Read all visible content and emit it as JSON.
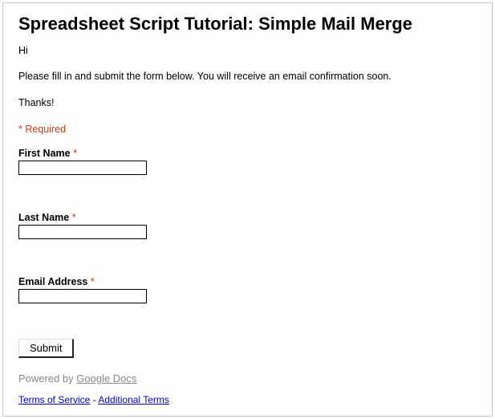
{
  "form": {
    "title": "Spreadsheet Script Tutorial: Simple Mail Merge",
    "greeting": "Hi",
    "instructions": "Please fill in and submit the form below. You will receive an email confirmation soon.",
    "thanks": "Thanks!",
    "required_note": "* Required",
    "fields": {
      "first_name": {
        "label": "First Name",
        "asterisk": "*",
        "value": ""
      },
      "last_name": {
        "label": "Last Name",
        "asterisk": "*",
        "value": ""
      },
      "email": {
        "label": "Email Address",
        "asterisk": "*",
        "value": ""
      }
    },
    "submit_label": "Submit"
  },
  "footer": {
    "powered_by_prefix": "Powered by ",
    "powered_by_link": "Google Docs",
    "terms_link": "Terms of Service",
    "separator": " - ",
    "additional_link": "Additional Terms"
  }
}
